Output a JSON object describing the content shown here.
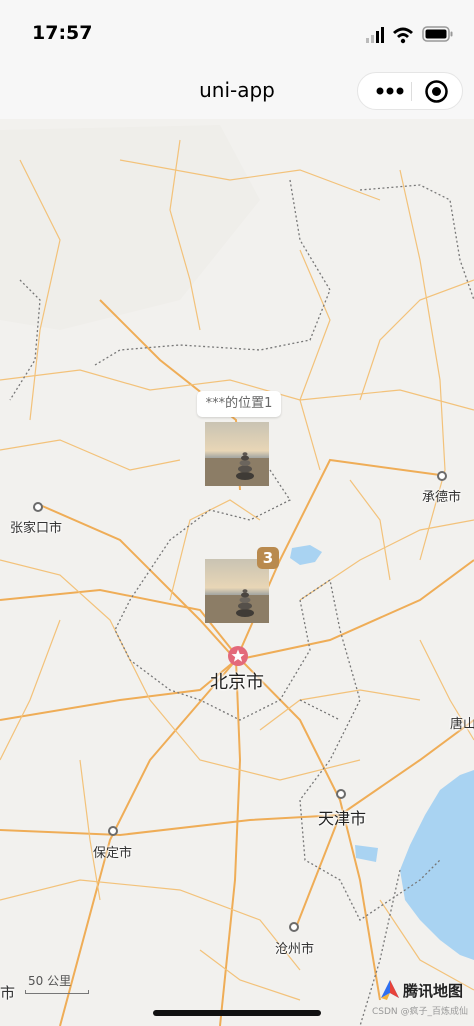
{
  "status_bar": {
    "time": "17:57"
  },
  "nav": {
    "title": "uni-app"
  },
  "map": {
    "markers": [
      {
        "callout": "***的位置1",
        "cluster_count": null
      },
      {
        "callout": null,
        "cluster_count": "3"
      }
    ],
    "cities": [
      {
        "name": "承德市"
      },
      {
        "name": "张家口市"
      },
      {
        "name": "北京市"
      },
      {
        "name": "唐山"
      },
      {
        "name": "天津市"
      },
      {
        "name": "保定市"
      },
      {
        "name": "沧州市"
      },
      {
        "name": "市"
      }
    ],
    "scale_label": "50 公里",
    "logo_text": "腾讯地图",
    "watermark": "CSDN @疯子_百炼成仙",
    "colors": {
      "road": "#f3c27a",
      "highway": "#efad57",
      "border": "#777777",
      "water": "#a9d3f2",
      "land": "#f2f1ee"
    }
  }
}
